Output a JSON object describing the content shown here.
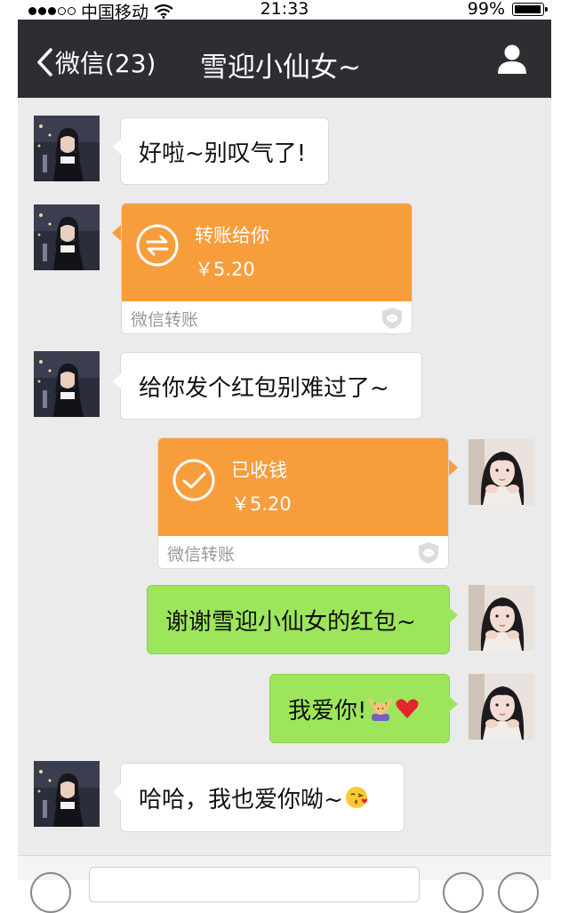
{
  "status_bar": {
    "carrier": "中国移动",
    "time": "21:33",
    "battery": "99%",
    "battery_level": 0.99,
    "signal_bars": 3,
    "signal_total": 5
  },
  "nav": {
    "back_label": "微信(23)",
    "title": "雪迎小仙女~"
  },
  "messages": [
    {
      "side": "left",
      "type": "text",
      "text": "好啦~别叹气了!"
    },
    {
      "side": "left",
      "type": "transfer",
      "label": "转账给你",
      "amount": "￥5.20",
      "footer": "微信转账"
    },
    {
      "side": "left",
      "type": "text",
      "text": "给你发个红包别难过了~"
    },
    {
      "side": "right",
      "type": "transfer",
      "label": "已收钱",
      "amount": "￥5.20",
      "footer": "微信转账"
    },
    {
      "side": "right",
      "type": "text",
      "text": "谢谢雪迎小仙女的红包~"
    },
    {
      "side": "right",
      "type": "text",
      "text": "我爱你!",
      "emojis": [
        "person-raising-hands-emoji",
        "red-heart-emoji"
      ]
    },
    {
      "side": "left",
      "type": "text",
      "text": "哈哈，我也爱你呦~",
      "emojis": [
        "face-blowing-kiss-emoji"
      ]
    }
  ],
  "colors": {
    "nav_bg": "#2e2e32",
    "chat_bg": "#ebebeb",
    "green_bubble": "#9de65b",
    "transfer_orange": "#f89d3c"
  },
  "icons": {
    "back": "chevron-left-icon",
    "profile": "person-icon",
    "transfer_pending": "exchange-arrows-icon",
    "transfer_received": "checkmark-circle-icon",
    "transfer_footer": "wechat-shield-icon"
  }
}
